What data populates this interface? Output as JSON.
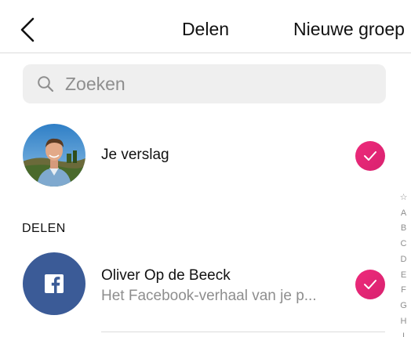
{
  "header": {
    "title": "Delen",
    "action_label": "Nieuwe groep"
  },
  "search": {
    "placeholder": "Zoeken"
  },
  "story": {
    "label": "Je verslag",
    "selected": true
  },
  "section": {
    "label": "DELEN"
  },
  "targets": [
    {
      "name": "Oliver Op de Beeck",
      "subtitle": "Het Facebook-verhaal van je p...",
      "icon": "facebook-icon",
      "selected": true
    }
  ],
  "alphabet_index": [
    "☆",
    "A",
    "B",
    "C",
    "D",
    "E",
    "F",
    "G",
    "H",
    "I"
  ],
  "colors": {
    "accent": "#e1306c",
    "facebook": "#3b5b97",
    "secondary_text": "#8e8e8e",
    "search_bg": "#efefef"
  }
}
